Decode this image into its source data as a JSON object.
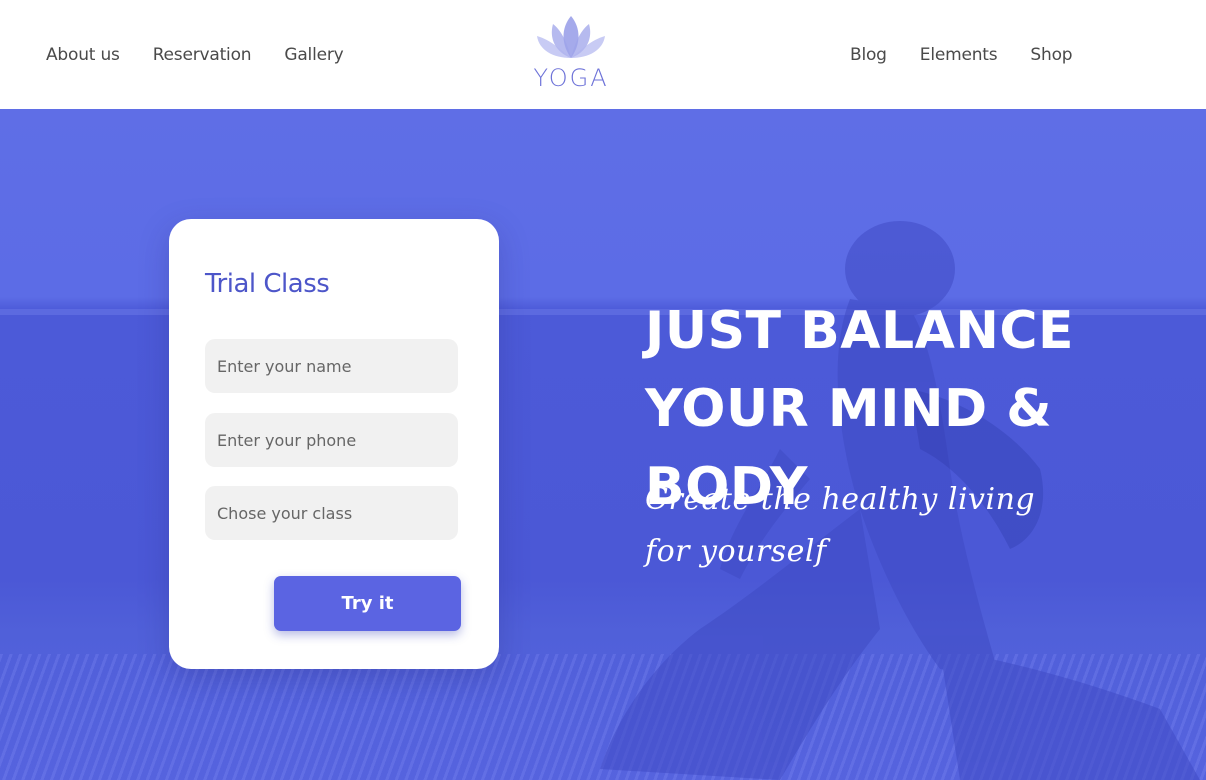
{
  "nav": {
    "left": [
      "About us",
      "Reservation",
      "Gallery"
    ],
    "right": [
      "Blog",
      "Elements",
      "Shop"
    ]
  },
  "logo": {
    "text": "YOGA",
    "icon": "lotus-icon"
  },
  "trial": {
    "title": "Trial Class",
    "name_placeholder": "Enter your name",
    "phone_placeholder": "Enter your phone",
    "class_placeholder": "Chose your class",
    "button_label": "Try it"
  },
  "hero": {
    "headline_line1": "JUST BALANCE",
    "headline_line2": "YOUR MIND & BODY",
    "tagline_line1": "Create the healthy living",
    "tagline_line2": "for yourself"
  },
  "colors": {
    "accent": "#5b64e2",
    "hero_overlay": "#4b58d6",
    "logo": "#6d72d8"
  }
}
